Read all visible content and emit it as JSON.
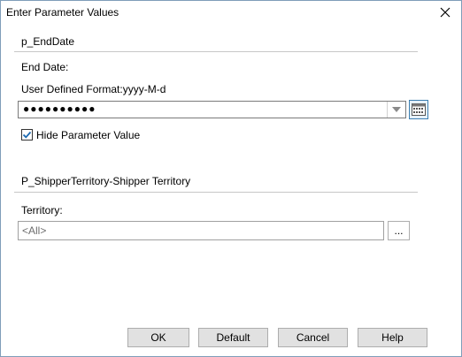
{
  "dialog": {
    "title": "Enter Parameter Values"
  },
  "params": {
    "end_date": {
      "section_title": "p_EndDate",
      "label": "End Date:",
      "format": "User Defined Format:yyyy-M-d",
      "masked_value": "●●●●●●●●●●",
      "hide_label": "Hide Parameter Value",
      "hide_checked": true
    },
    "territory": {
      "section_title": "P_ShipperTerritory-Shipper Territory",
      "label": "Territory:",
      "value": "<All>",
      "browse_label": "..."
    }
  },
  "buttons": {
    "ok": "OK",
    "default": "Default",
    "cancel": "Cancel",
    "help": "Help"
  },
  "icons": {
    "close": "close-icon",
    "dropdown": "chevron-down-icon",
    "calendar": "calendar-icon",
    "check": "checkmark-icon"
  },
  "colors": {
    "accent": "#3c7fb1",
    "check": "#1c6ab2",
    "separator": "#c7c7c7"
  }
}
